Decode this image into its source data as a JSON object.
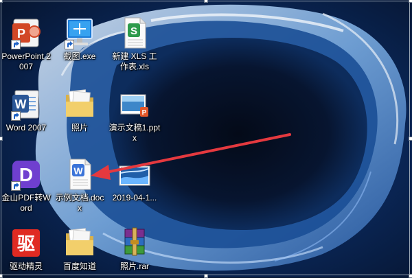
{
  "desktop": {
    "icons": [
      {
        "label": "PowerPoint 2007",
        "icon": "powerpoint-icon"
      },
      {
        "label": "截图.exe",
        "icon": "screenshot-exe-icon"
      },
      {
        "label": "新建 XLS 工作表.xls",
        "icon": "xls-file-icon"
      },
      {
        "label": "Word 2007",
        "icon": "word-icon"
      },
      {
        "label": "照片",
        "icon": "folder-icon"
      },
      {
        "label": "演示文稿1.pptx",
        "icon": "pptx-file-icon"
      },
      {
        "label": "金山PDF转Word",
        "icon": "pdf-to-word-icon"
      },
      {
        "label": "示例文档.docx",
        "icon": "docx-file-icon"
      },
      {
        "label": "2019-04-1...",
        "icon": "image-file-icon"
      },
      {
        "label": "驱动精灵",
        "icon": "driver-genius-icon"
      },
      {
        "label": "百度知道",
        "icon": "folder-icon"
      },
      {
        "label": "照片.rar",
        "icon": "rar-archive-icon"
      }
    ]
  },
  "annotation": {
    "color": "#e5393f",
    "icon": "red-arrow"
  },
  "glyphs": {
    "driver_char": "驱",
    "word_w": "W",
    "xls_s": "S",
    "pdf_d": "D",
    "ppt_p": "P"
  }
}
